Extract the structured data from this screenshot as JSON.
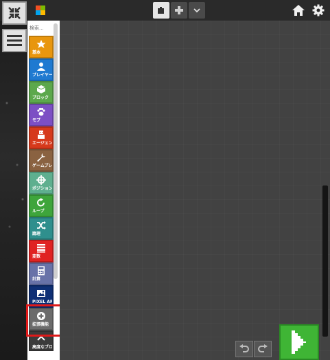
{
  "toolbar": {
    "fullscreen_icon": "collapse-arrows-icon",
    "menu_icon": "hamburger-icon",
    "logo_colors": [
      "#f25022",
      "#7fba00",
      "#00a4ef",
      "#ffb900"
    ],
    "view_toggle": [
      "block-view",
      "code-view",
      "dropdown"
    ],
    "home_icon": "home-icon",
    "settings_icon": "gear-icon"
  },
  "toolbox": {
    "search_placeholder": "検索...",
    "categories": [
      {
        "label": "基本",
        "color": "#e8960d",
        "icon": "star-icon"
      },
      {
        "label": "プレイヤー",
        "color": "#1f7ad1",
        "icon": "person-icon"
      },
      {
        "label": "ブロック",
        "color": "#5ca84c",
        "icon": "cube-icon"
      },
      {
        "label": "モブ",
        "color": "#7c4fc4",
        "icon": "paw-icon"
      },
      {
        "label": "エージェント",
        "color": "#d6391b",
        "icon": "agent-icon"
      },
      {
        "label": "ゲームプレイ",
        "color": "#8a6241",
        "icon": "wrench-icon"
      },
      {
        "label": "ポジション",
        "color": "#5eaf8f",
        "icon": "crosshair-icon"
      },
      {
        "label": "ループ",
        "color": "#3ea53b",
        "icon": "loop-icon"
      },
      {
        "label": "論理",
        "color": "#2f8f8d",
        "icon": "shuffle-icon"
      },
      {
        "label": "変数",
        "color": "#e02222",
        "icon": "list-icon"
      },
      {
        "label": "計算",
        "color": "#6872a8",
        "icon": "calculator-icon"
      },
      {
        "label": "PIXEL AR",
        "color": "#0e2f75",
        "icon": "image-icon"
      },
      {
        "label": "拡張機能",
        "color": "#6b6b6b",
        "icon": "plus-circle-icon"
      },
      {
        "label": "高度なブロ",
        "color": "#3b3b3b",
        "icon": "chevron-up-icon"
      }
    ]
  },
  "workspace": {
    "undo_icon": "undo-icon",
    "redo_icon": "redo-icon",
    "run_icon": "play-icon"
  }
}
